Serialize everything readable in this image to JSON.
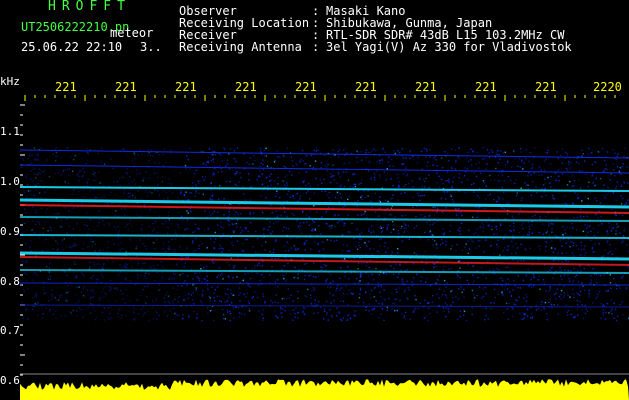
{
  "header": {
    "brand": "HROFFT",
    "filename": "UT2506222210.pn",
    "meteor_label": "meteor",
    "datetime": "25.06.22 22:10",
    "count": "3..",
    "info": [
      {
        "label": "Observer",
        "sep": ":",
        "value": "Masaki Kano"
      },
      {
        "label": "Receiving Location",
        "sep": ":",
        "value": "Shibukawa, Gunma, Japan"
      },
      {
        "label": "Receiver",
        "sep": ":",
        "value": "RTL-SDR SDR# 43dB L15 103.2MHz CW"
      },
      {
        "label": "Receiving Antenna",
        "sep": ":",
        "value": "3el Yagi(V) Az 330 for Vladivostok"
      }
    ]
  },
  "axes": {
    "y_unit": "kHz",
    "y_ticks": [
      "1.1",
      "1.0",
      "0.9",
      "0.8",
      "0.7",
      "0.6"
    ],
    "x_ticks": [
      "221",
      "221",
      "221",
      "221",
      "221",
      "221",
      "221",
      "221",
      "221",
      "2220"
    ]
  },
  "colors": {
    "background": "#000000",
    "brand_green": "#44ff44",
    "axis_yellow": "#ffff00",
    "noise_blue": "#1030ff",
    "signal_cyan": "#20e0ff",
    "signal_red": "#ff2020"
  }
}
